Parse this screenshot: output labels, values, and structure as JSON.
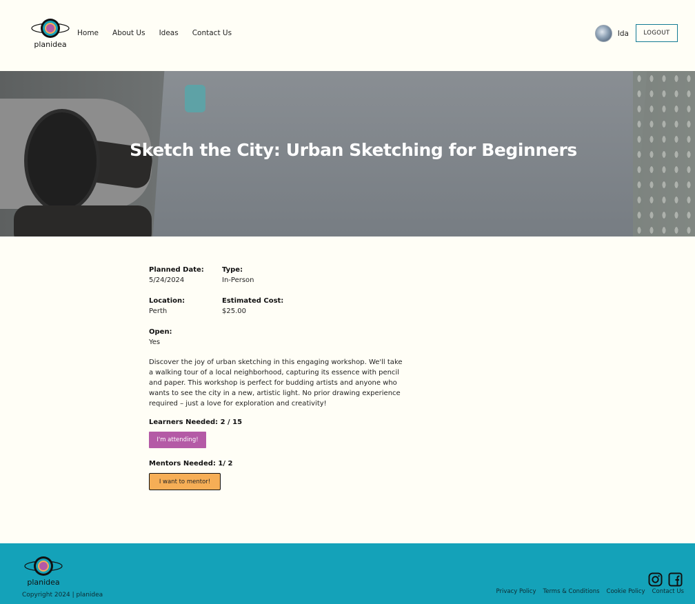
{
  "header": {
    "logo_text": "planidea",
    "nav": [
      "Home",
      "About Us",
      "Ideas",
      "Contact Us"
    ],
    "user_name": "Ida",
    "logout_label": "LOGOUT"
  },
  "hero": {
    "title": "Sketch the City: Urban Sketching for Beginners"
  },
  "details": {
    "planned_date_label": "Planned Date:",
    "planned_date": "5/24/2024",
    "type_label": "Type:",
    "type": "In-Person",
    "location_label": "Location:",
    "location": "Perth",
    "cost_label": "Estimated Cost:",
    "cost": "$25.00",
    "open_label": "Open:",
    "open": "Yes",
    "description": "Discover the joy of urban sketching in this engaging workshop. We'll take a walking tour of a local neighborhood, capturing its essence with pencil and paper. This workshop is perfect for budding artists and anyone who wants to see the city in a new, artistic light. No prior drawing experience required – just a love for exploration and creativity!",
    "learners_needed": "Learners Needed: 2 / 15",
    "attend_button": "I'm attending!",
    "mentors_needed": "Mentors Needed: 1/ 2",
    "mentor_button": "I want to mentor!"
  },
  "footer": {
    "logo_text": "planidea",
    "copyright": "Copyright 2024 | planidea",
    "links": [
      "Privacy Policy",
      "Terms & Conditions",
      "Cookie Policy",
      "Contact Us"
    ],
    "social_icons": [
      "instagram-icon",
      "facebook-icon"
    ]
  },
  "colors": {
    "background": "#fffef6",
    "footer": "#14a2b9",
    "attend_button": "#b45aa6",
    "mentor_button": "#f6ae56",
    "logout_border": "#127a94"
  }
}
